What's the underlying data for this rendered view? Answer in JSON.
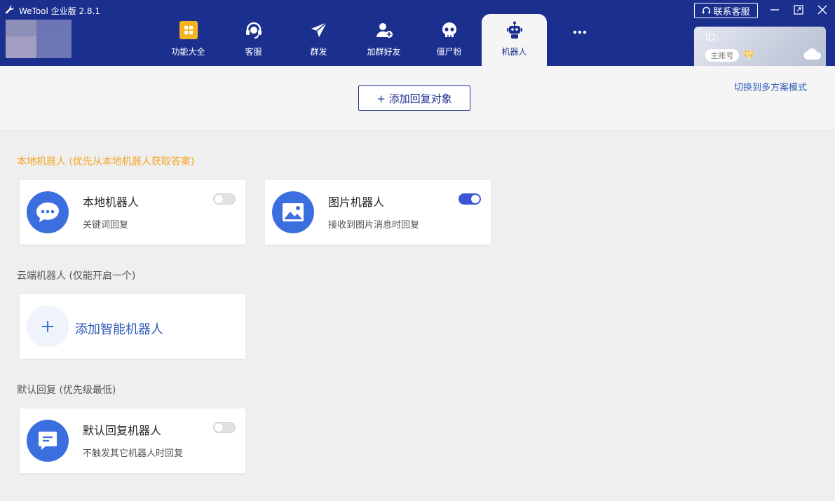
{
  "app": {
    "title": "WeTool 企业版 2.8.1"
  },
  "nav": {
    "items": [
      {
        "label": "功能大全",
        "icon": "grid-icon"
      },
      {
        "label": "客服",
        "icon": "headset-icon"
      },
      {
        "label": "群发",
        "icon": "send-icon"
      },
      {
        "label": "加群好友",
        "icon": "add-user-icon"
      },
      {
        "label": "僵尸粉",
        "icon": "skull-icon"
      },
      {
        "label": "机器人",
        "icon": "robot-icon",
        "active": true
      },
      {
        "label": "",
        "icon": "more-icon"
      }
    ]
  },
  "header": {
    "contact_label": "联系客服",
    "id_label": "ID:",
    "account_badge": "主账号"
  },
  "topbar": {
    "add_target_label": "+ 添加回复对象",
    "switch_mode_label": "切换到多方案模式"
  },
  "sections": {
    "local": {
      "title": "本地机器人 (优先从本地机器人获取答案)",
      "cards": [
        {
          "name": "本地机器人",
          "desc": "关键词回复",
          "enabled": false,
          "icon": "chat-bubble-icon"
        },
        {
          "name": "图片机器人",
          "desc": "接收到图片消息时回复",
          "enabled": true,
          "icon": "image-icon"
        }
      ]
    },
    "cloud": {
      "title": "云端机器人 (仅能开启一个)",
      "add_label": "添加智能机器人"
    },
    "default": {
      "title": "默认回复 (优先级最低)",
      "cards": [
        {
          "name": "默认回复机器人",
          "desc": "不触发其它机器人时回复",
          "enabled": false,
          "icon": "message-icon"
        }
      ]
    }
  },
  "colors": {
    "header_bg": "#1b2f8f",
    "accent": "#3b6fe0",
    "toggle_on": "#3b57d6",
    "warn": "#f5a623"
  }
}
